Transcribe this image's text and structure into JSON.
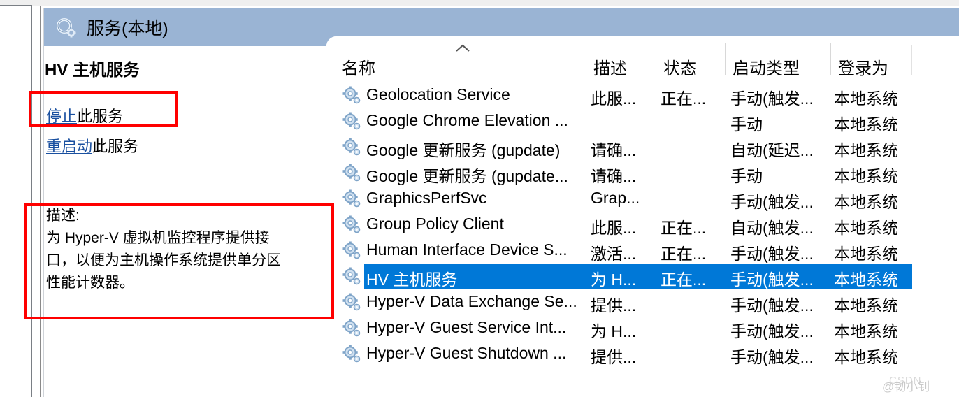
{
  "window": {
    "titlebar_icon": "services-gear-icon",
    "title": "服务(本地)",
    "titlebar_color": "#9ab4d4"
  },
  "detail_pane": {
    "service_title": "HV 主机服务",
    "actions": [
      {
        "id": "stop",
        "link_text": "停止",
        "suffix_text": "此服务"
      },
      {
        "id": "restart",
        "link_text": "重启动",
        "suffix_text": "此服务"
      }
    ],
    "description_label": "描述:",
    "description_lines": [
      "为 Hyper-V 虚拟机监控程序提供接",
      "口，以便为主机操作系统提供单分区",
      "性能计数器。"
    ]
  },
  "annotations": {
    "color": "#ff0000",
    "boxes": [
      {
        "id": "redbox-stop",
        "targets": "停止此服务"
      },
      {
        "id": "redbox-desc",
        "targets": "描述"
      }
    ]
  },
  "list": {
    "sort_indicator": "caret-up-icon",
    "columns": [
      {
        "key": "name",
        "label": "名称"
      },
      {
        "key": "desc",
        "label": "描述"
      },
      {
        "key": "state",
        "label": "状态"
      },
      {
        "key": "start",
        "label": "启动类型"
      },
      {
        "key": "logon",
        "label": "登录为"
      }
    ],
    "selected_color": "#0078d7",
    "rows": [
      {
        "icon": "service-gear-icon",
        "name": "Geolocation Service",
        "desc": "此服...",
        "state": "正在...",
        "start": "手动(触发...",
        "logon": "本地系统",
        "selected": false
      },
      {
        "icon": "service-gear-icon",
        "name": "Google Chrome Elevation ...",
        "desc": "",
        "state": "",
        "start": "手动",
        "logon": "本地系统",
        "selected": false
      },
      {
        "icon": "service-gear-icon",
        "name": "Google 更新服务 (gupdate)",
        "desc": "请确...",
        "state": "",
        "start": "自动(延迟...",
        "logon": "本地系统",
        "selected": false
      },
      {
        "icon": "service-gear-icon",
        "name": "Google 更新服务 (gupdate...",
        "desc": "请确...",
        "state": "",
        "start": "手动",
        "logon": "本地系统",
        "selected": false
      },
      {
        "icon": "service-gear-icon",
        "name": "GraphicsPerfSvc",
        "desc": "Grap...",
        "state": "",
        "start": "手动(触发...",
        "logon": "本地系统",
        "selected": false
      },
      {
        "icon": "service-gear-icon",
        "name": "Group Policy Client",
        "desc": "此服...",
        "state": "正在...",
        "start": "自动(触发...",
        "logon": "本地系统",
        "selected": false
      },
      {
        "icon": "service-gear-icon",
        "name": "Human Interface Device S...",
        "desc": "激活...",
        "state": "正在...",
        "start": "手动(触发...",
        "logon": "本地系统",
        "selected": false
      },
      {
        "icon": "service-gear-icon",
        "name": "HV 主机服务",
        "desc": "为 H...",
        "state": "正在...",
        "start": "手动(触发...",
        "logon": "本地系统",
        "selected": true
      },
      {
        "icon": "service-gear-icon",
        "name": "Hyper-V Data Exchange Se...",
        "desc": "提供...",
        "state": "",
        "start": "手动(触发...",
        "logon": "本地系统",
        "selected": false
      },
      {
        "icon": "service-gear-icon",
        "name": "Hyper-V Guest Service Int...",
        "desc": "为 H...",
        "state": "",
        "start": "手动(触发...",
        "logon": "本地系统",
        "selected": false
      },
      {
        "icon": "service-gear-icon",
        "name": "Hyper-V Guest Shutdown ...",
        "desc": "提供...",
        "state": "",
        "start": "手动(触发...",
        "logon": "本地系统",
        "selected": false
      }
    ]
  },
  "watermark": {
    "text": "@韧小钊",
    "sub": "CSDN"
  }
}
